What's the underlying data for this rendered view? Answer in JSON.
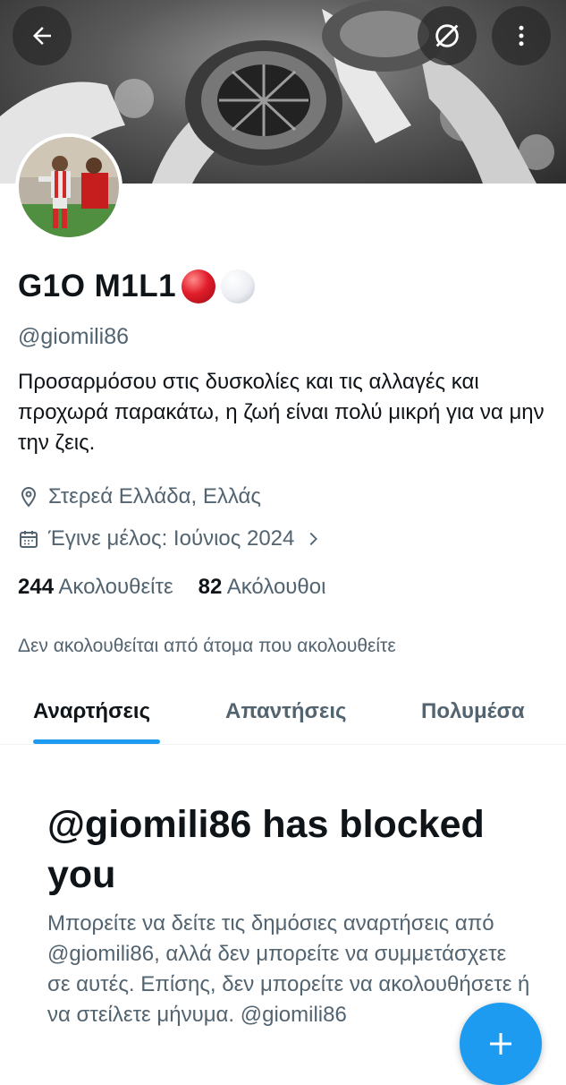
{
  "header": {
    "back_icon": "arrow-left-icon",
    "grok_icon": "slash-circle-icon",
    "more_icon": "more-vertical-icon"
  },
  "profile": {
    "display_name": "G1O M1L1",
    "emojis": [
      "red-circle",
      "white-circle"
    ],
    "handle": "@giomili86",
    "bio": "Προσαρμόσου στις δυσκολίες και τις αλλαγές και προχωρά παρακάτω, η ζωή είναι πολύ μικρή για να μην την ζεις.",
    "location": "Στερεά Ελλάδα, Ελλάς",
    "joined": "Έγινε μέλος: Ιούνιος 2024",
    "following_count": "244",
    "following_label": "Ακολουθείτε",
    "followers_count": "82",
    "followers_label": "Ακόλουθοι",
    "not_followed_text": "Δεν ακολουθείται από άτομα που ακολουθείτε"
  },
  "tabs": [
    {
      "label": "Αναρτήσεις",
      "active": true
    },
    {
      "label": "Απαντήσεις",
      "active": false
    },
    {
      "label": "Πολυμέσα",
      "active": false
    }
  ],
  "blocked": {
    "title": "@giomili86 has blocked you",
    "text": "Μπορείτε να δείτε τις δημόσιες αναρτήσεις από @giomili86, αλλά δεν μπορείτε να συμμετάσχετε σε αυτές. Επίσης, δεν μπορείτε να ακολουθήσετε ή να στείλετε μήνυμα. @giomili86"
  },
  "fab": {
    "icon": "plus-icon"
  },
  "colors": {
    "accent": "#1d9bf0",
    "secondary_text": "#536471",
    "primary_text": "#0f1419"
  }
}
